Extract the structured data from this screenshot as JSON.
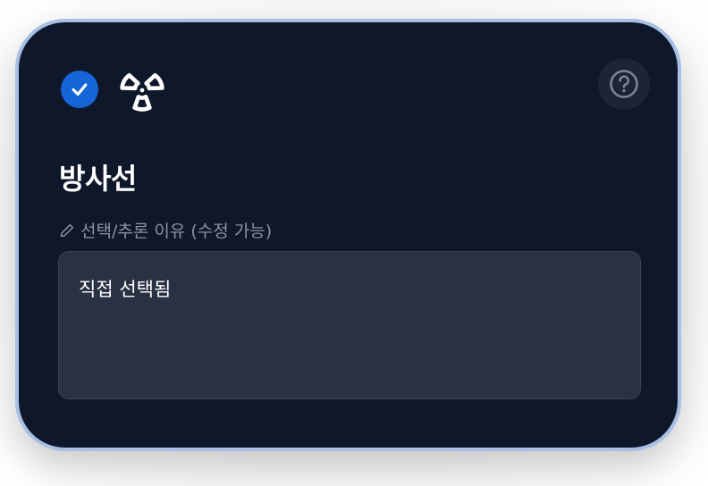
{
  "card": {
    "selected": true,
    "icon": "radiation-icon",
    "title": "방사선",
    "reason_label": "선택/추론 이유 (수정 가능)",
    "reason_value": "직접 선택됨"
  },
  "icons": {
    "check": "check-icon",
    "help": "help-icon",
    "edit": "pencil-icon"
  },
  "colors": {
    "card_bg": "#0f172a",
    "card_border": "#a8c0e4",
    "check_bg": "#1565d8",
    "textbox_bg": "#293142",
    "label_text": "#8b93a3"
  }
}
